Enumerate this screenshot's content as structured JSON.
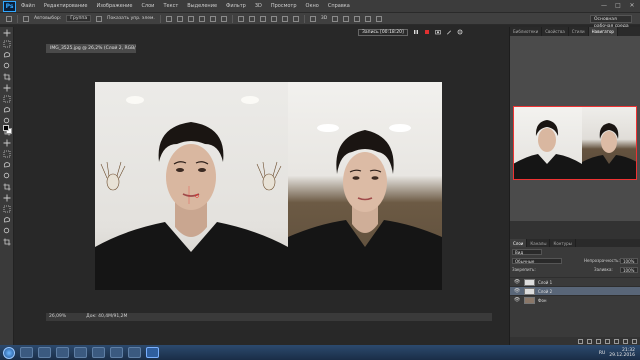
{
  "app": {
    "logo": "Ps"
  },
  "menu": [
    "Файл",
    "Редактирование",
    "Изображение",
    "Слои",
    "Текст",
    "Выделение",
    "Фильтр",
    "3D",
    "Просмотр",
    "Окно",
    "Справка"
  ],
  "window_controls": [
    "—",
    "□",
    "✕"
  ],
  "options": {
    "auto_select_label": "Автовыбор:",
    "auto_select_value": "Группа",
    "show_controls_label": "Показать упр. элем."
  },
  "workspace": {
    "selected": "Основная рабочая среда"
  },
  "document": {
    "tab_title": "IMG_3525.jpg @ 26,2% (Слой 2, RGB/8*) *",
    "zoom": "26,09%",
    "doc_info": "Док: 40,4M/91,2M"
  },
  "recording": {
    "label": "Запись [00:18:20]"
  },
  "dock": {
    "top_tabs": [
      "Библиотеки",
      "Свойства",
      "Стили",
      "Навигатор"
    ],
    "active_top_tab": "Навигатор"
  },
  "layers": {
    "tabs": [
      "Слои",
      "Каналы",
      "Контуры"
    ],
    "filter": "Вид",
    "blend_mode": "Обычные",
    "opacity_label": "Непрозрачность:",
    "opacity_value": "100%",
    "lock_label": "Закрепить:",
    "fill_label": "Заливка:",
    "fill_value": "100%",
    "items": [
      {
        "name": "Слой 1",
        "selected": false
      },
      {
        "name": "Слой 2",
        "selected": true
      },
      {
        "name": "Фон",
        "selected": false
      }
    ]
  },
  "taskbar": {
    "lang": "RU",
    "time": "21:32",
    "date": "29.12.2016"
  },
  "tools": [
    "move-tool-icon",
    "marquee-tool-icon",
    "lasso-tool-icon",
    "quick-select-tool-icon",
    "crop-tool-icon",
    "eyedropper-tool-icon",
    "healing-tool-icon",
    "brush-tool-icon",
    "clone-stamp-tool-icon",
    "history-brush-tool-icon",
    "eraser-tool-icon",
    "gradient-tool-icon",
    "blur-tool-icon",
    "dodge-tool-icon",
    "pen-tool-icon",
    "type-tool-icon",
    "path-select-tool-icon",
    "shape-tool-icon",
    "hand-tool-icon",
    "zoom-tool-icon"
  ],
  "colors": {
    "foreground": "#000000",
    "background": "#ffffff",
    "accent": "#31a8ff"
  }
}
